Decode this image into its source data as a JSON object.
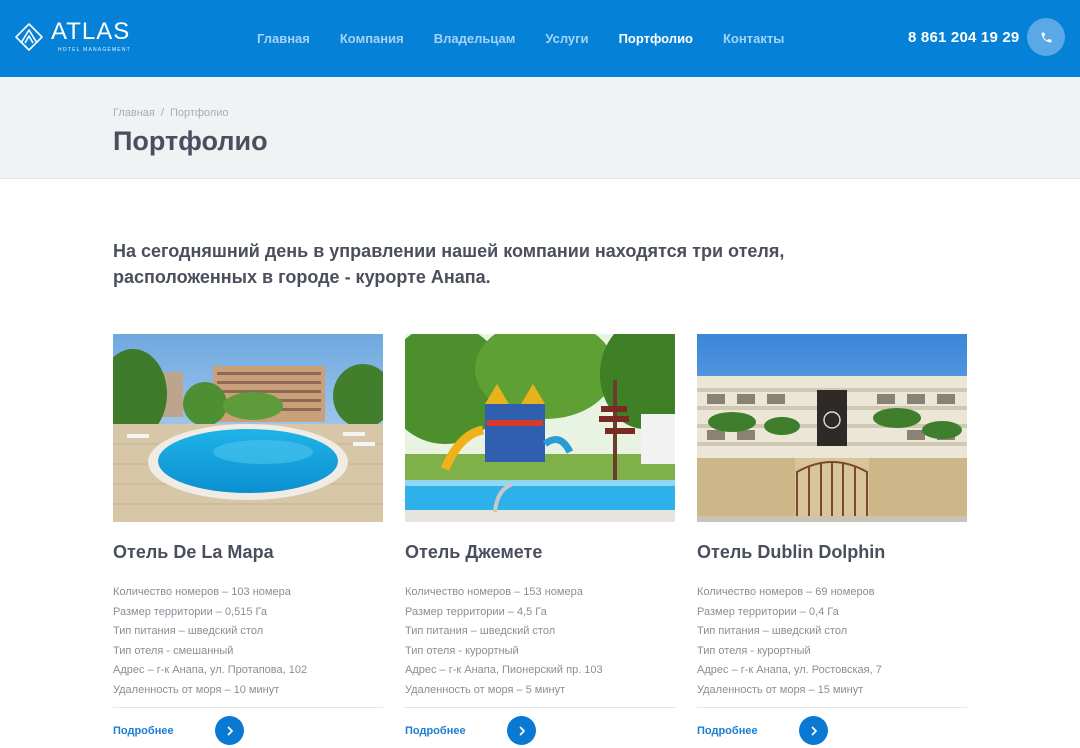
{
  "header": {
    "logo": {
      "name": "ATLAS",
      "subtitle": "Hotel Management"
    },
    "nav": [
      {
        "label": "Главная",
        "active": false
      },
      {
        "label": "Компания",
        "active": false
      },
      {
        "label": "Владельцам",
        "active": false
      },
      {
        "label": "Услуги",
        "active": false
      },
      {
        "label": "Портфолио",
        "active": true
      },
      {
        "label": "Контакты",
        "active": false
      }
    ],
    "phone": "8 861 204 19 29",
    "call_icon": "phone-icon"
  },
  "breadcrumb": {
    "home": "Главная",
    "separator": "/",
    "current": "Портфолио"
  },
  "page_title": "Портфолио",
  "intro": "На сегодняшний день в управлении нашей компании находятся три отеля, расположенных в городе - курорте Анапа.",
  "hotels": [
    {
      "name": "Отель De La Мара",
      "photo": "hotel-pool-photo",
      "details": [
        "Количество номеров – 103 номера",
        "Размер территории – 0,515 Га",
        "Тип питания – шведский стол",
        "Тип отеля - смешанный",
        "Адрес – г-к Анапа, ул. Протапова, 102",
        "Удаленность от моря – 10 минут"
      ],
      "more_label": "Подробнее"
    },
    {
      "name": "Отель Джемете",
      "photo": "playground-pool-photo",
      "details": [
        "Количество номеров – 153 номера",
        "Размер территории – 4,5 Га",
        "Тип питания – шведский стол",
        "Тип отеля - курортный",
        "Адрес – г-к Анапа, Пионерский пр. 103",
        "Удаленность от моря – 5 минут"
      ],
      "more_label": "Подробнее"
    },
    {
      "name": "Отель Dublin Dolphin",
      "photo": "hotel-facade-photo",
      "details": [
        "Количество номеров – 69 номеров",
        "Размер территории – 0,4 Га",
        "Тип питания – шведский стол",
        "Тип отеля - курортный",
        "Адрес – г-к Анапа, ул. Ростовская, 7",
        "Удаленность от моря – 15 минут"
      ],
      "more_label": "Подробнее"
    }
  ],
  "colors": {
    "header_bg": "#0582d8",
    "accent": "#0a79d3",
    "title": "#4b4f5d",
    "band": "#f1f2f4"
  }
}
